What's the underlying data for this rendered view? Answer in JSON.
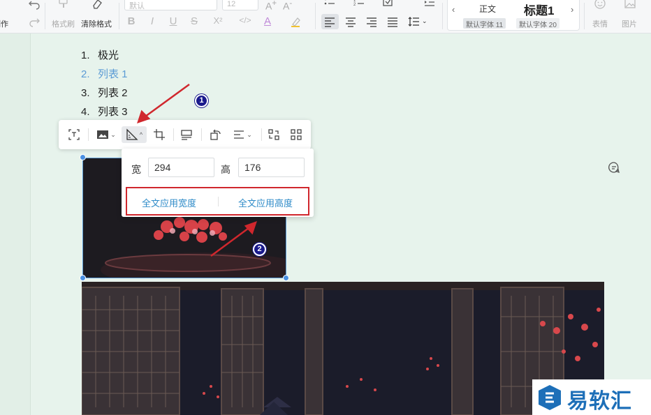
{
  "ribbon": {
    "cut_label_partial": "制作",
    "format_painter_label": "格式刷",
    "clear_format_label": "清除格式",
    "font_name": "默认",
    "font_size": "12",
    "bold": "B",
    "italic": "I",
    "underline": "U",
    "strike": "S",
    "superscript": "X²",
    "code": "</>",
    "font_color": "A",
    "style_normal": "正文",
    "style_heading1": "标题1",
    "style_normal_sub": "默认字体 11",
    "style_heading1_sub": "默认字体 20",
    "emoji_label": "表情",
    "image_label": "图片"
  },
  "document": {
    "list": [
      {
        "num": "1.",
        "text": "极光"
      },
      {
        "num": "2.",
        "text": "列表 1"
      },
      {
        "num": "3.",
        "text": "列表 2"
      },
      {
        "num": "4.",
        "text": "列表 3"
      }
    ]
  },
  "size_popup": {
    "width_label": "宽",
    "width_value": "294",
    "height_label": "高",
    "height_value": "176",
    "apply_width": "全文应用宽度",
    "apply_height": "全文应用高度"
  },
  "badges": {
    "one": "1",
    "two": "2"
  },
  "watermark": {
    "text": "易软汇"
  },
  "colors": {
    "accent": "#4a90e2",
    "highlight_box": "#d0272d",
    "link": "#2e8bc8",
    "arrow": "#d0272d"
  }
}
